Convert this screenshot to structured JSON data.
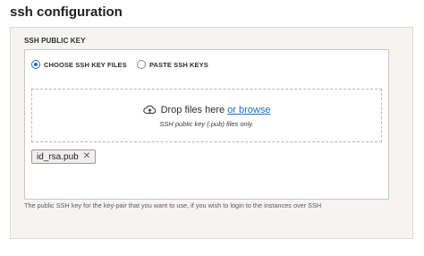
{
  "section": {
    "title": "ssh configuration"
  },
  "ssh_key": {
    "label": "SSH PUBLIC KEY",
    "options": [
      {
        "label": "CHOOSE SSH KEY FILES",
        "selected": true
      },
      {
        "label": "PASTE SSH KEYS",
        "selected": false
      }
    ],
    "dropzone": {
      "prompt": "Drop files here",
      "browse_link": "or browse",
      "hint": "SSH public key (.pub) files only."
    },
    "files": [
      {
        "name": "id_rsa.pub"
      }
    ],
    "help_text": "The public SSH key for the key-pair that you want to use, if you wish to login to the instances over SSH"
  },
  "colors": {
    "accent": "#1f6fc5",
    "panel_bg": "#f5f4f2"
  },
  "icons": {
    "upload": "cloud-upload-icon",
    "remove": "close-icon"
  }
}
